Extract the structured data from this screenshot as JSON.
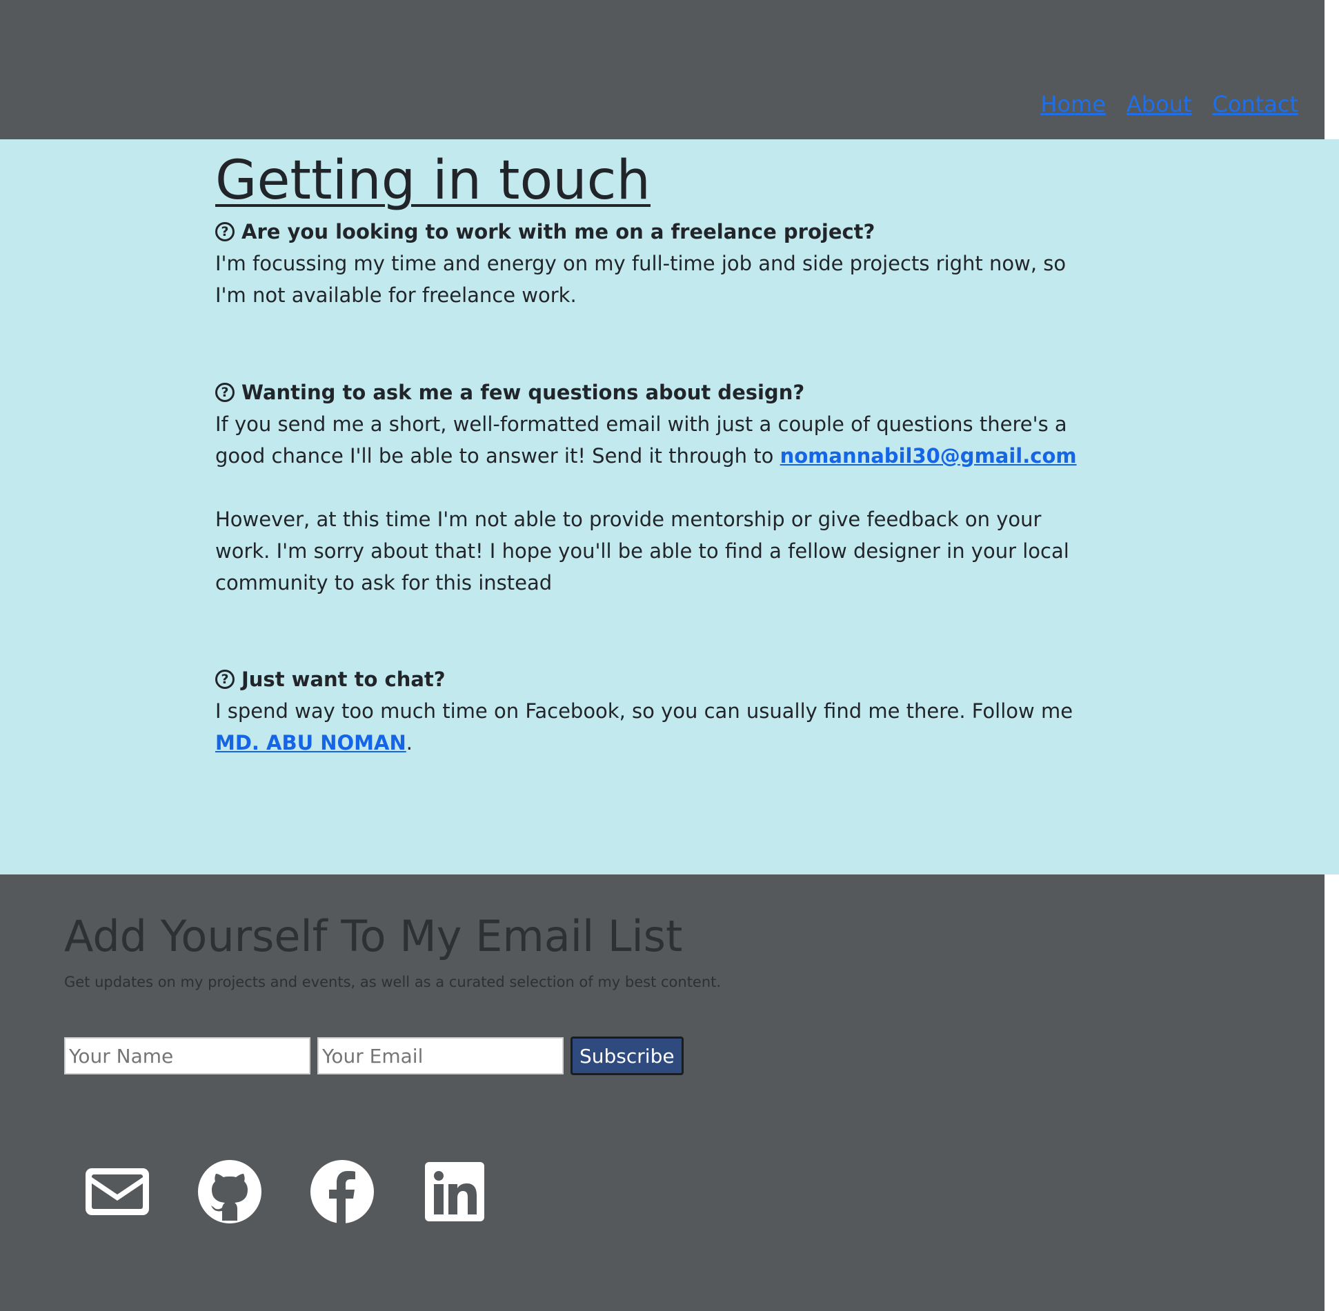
{
  "nav": {
    "items": [
      {
        "label": "Home"
      },
      {
        "label": "About"
      },
      {
        "label": "Contact"
      }
    ]
  },
  "main": {
    "title": "Getting in touch",
    "faqs": [
      {
        "question": "Are you looking to work with me on a freelance project?",
        "answer": "I'm focussing my time and energy on my full-time job and side projects right now, so I'm not available for freelance work."
      },
      {
        "question": "Wanting to ask me a few questions about design?",
        "answer_prefix": "If you send me a short, well-formatted email with just a couple of questions there's a good chance I'll be able to answer it! Send it through to ",
        "email_link": "nomannabil30@gmail.com",
        "answer_extra": "However, at this time I'm not able to provide mentorship or give feedback on your work. I'm sorry about that! I hope you'll be able to find a fellow designer in your local community to ask for this instead"
      },
      {
        "question": "Just want to chat?",
        "answer_prefix": "I spend way too much time on Facebook, so you can usually find me there. Follow me ",
        "profile_link": "MD. ABU NOMAN",
        "answer_suffix": "."
      }
    ]
  },
  "footer": {
    "title": "Add Yourself To My Email List",
    "subtitle": "Get updates on my projects and events, as well as a curated selection of my best content.",
    "form": {
      "name_placeholder": "Your Name",
      "email_placeholder": "Your Email",
      "subscribe_label": "Subscribe"
    },
    "socials": [
      {
        "icon": "envelope-icon"
      },
      {
        "icon": "github-icon"
      },
      {
        "icon": "facebook-icon"
      },
      {
        "icon": "linkedin-icon"
      }
    ]
  },
  "colors": {
    "header_bg": "#55595c",
    "main_bg": "#c2e9ee",
    "link": "#1565e6",
    "button_bg": "#2f4a7f"
  }
}
